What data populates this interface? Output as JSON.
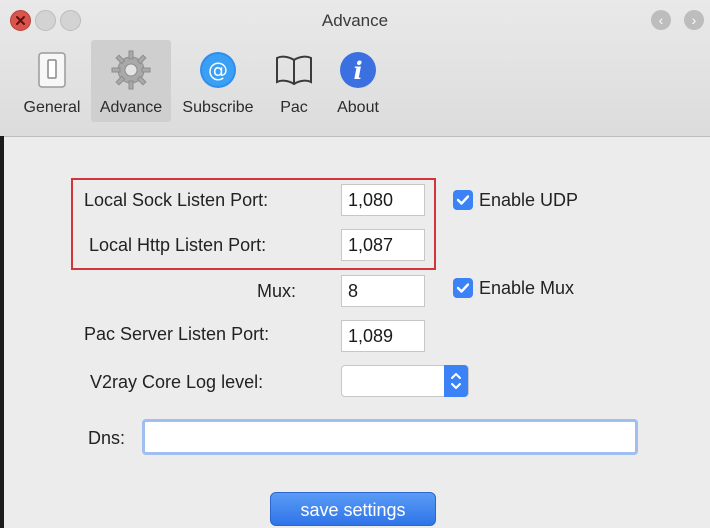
{
  "window": {
    "title": "Advance"
  },
  "toolbar": {
    "tabs": [
      {
        "id": "general",
        "label": "General",
        "icon": "switch-icon"
      },
      {
        "id": "advance",
        "label": "Advance",
        "icon": "gear-icon",
        "selected": true
      },
      {
        "id": "subscribe",
        "label": "Subscribe",
        "icon": "at-sign-icon"
      },
      {
        "id": "pac",
        "label": "Pac",
        "icon": "book-icon"
      },
      {
        "id": "about",
        "label": "About",
        "icon": "info-icon"
      }
    ]
  },
  "nav": {
    "back": "‹",
    "forward": "›"
  },
  "form": {
    "sock_port_label": "Local Sock Listen Port:",
    "sock_port_value": "1,080",
    "http_port_label": "Local Http Listen Port:",
    "http_port_value": "1,087",
    "mux_label": "Mux:",
    "mux_value": "8",
    "pac_port_label": "Pac Server Listen Port:",
    "pac_port_value": "1,089",
    "log_level_label": "V2ray Core Log level:",
    "log_level_value": "",
    "dns_label": "Dns:",
    "dns_value": "",
    "enable_udp_label": "Enable UDP",
    "enable_udp_checked": true,
    "enable_mux_label": "Enable Mux",
    "enable_mux_checked": true,
    "save_label": "save settings"
  },
  "colors": {
    "accent": "#3b82f6",
    "highlight_box": "#d1343a",
    "close_button": "#d9544d"
  }
}
